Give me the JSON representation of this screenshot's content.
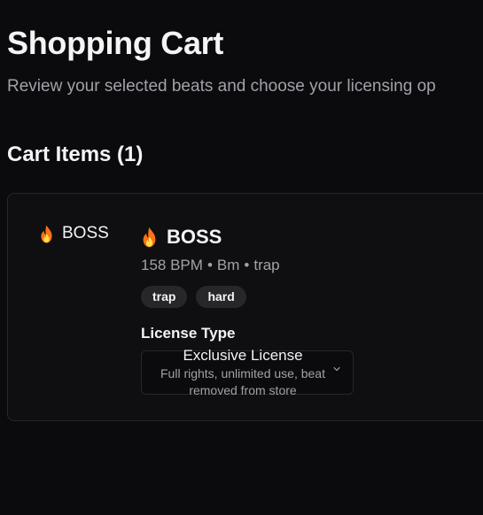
{
  "page": {
    "title": "Shopping Cart",
    "subtitle": "Review your selected beats and choose your licensing op"
  },
  "cart": {
    "heading": "Cart Items (1)",
    "items": [
      {
        "thumb_label": "BOSS",
        "title": "BOSS",
        "bpm": "158 BPM",
        "key": "Bm",
        "genre": "trap",
        "separator": "•",
        "tags": [
          "trap",
          "hard"
        ],
        "license": {
          "label": "License Type",
          "selected_name": "Exclusive License",
          "selected_description": "Full rights, unlimited use, beat removed from store"
        },
        "icon": "fire-icon"
      }
    ]
  },
  "colors": {
    "background": "#0b0b0d",
    "card": "#0f0f11",
    "border": "#27272a",
    "muted_text": "#a1a1aa",
    "tag_bg": "#27272a",
    "fire": "#f97316"
  }
}
